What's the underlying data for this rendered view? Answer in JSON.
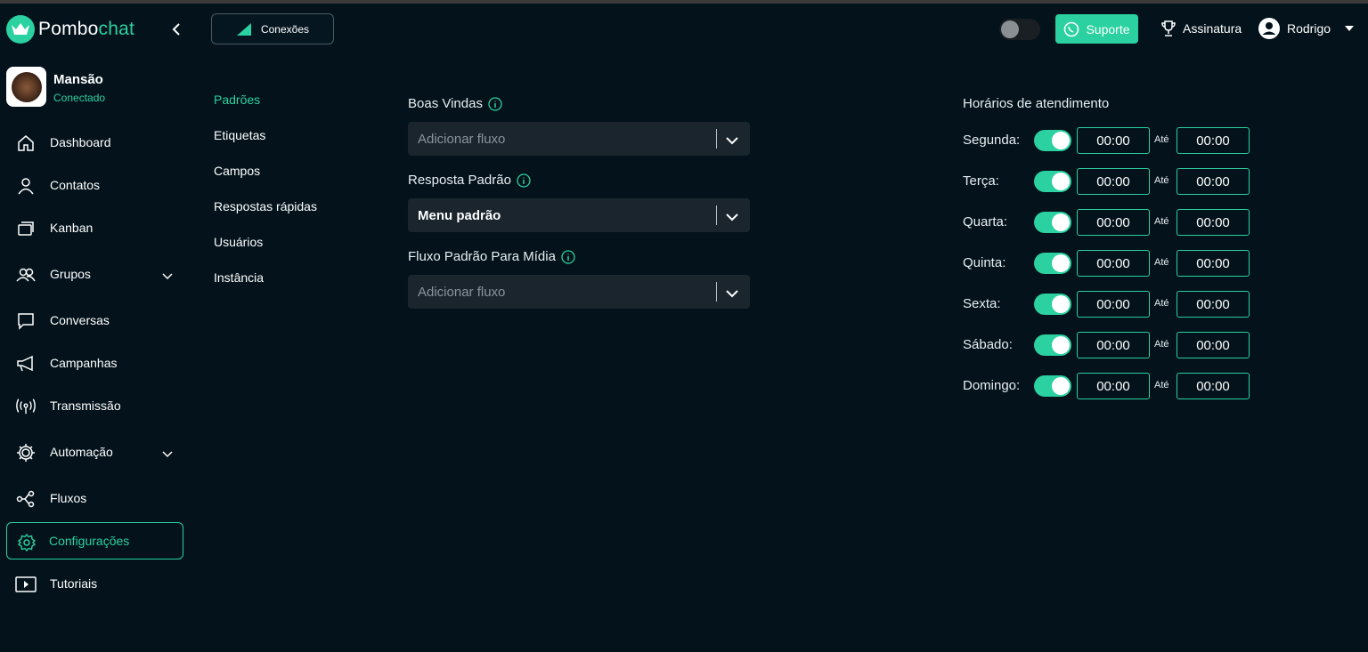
{
  "app": {
    "name_part1": "Pombo",
    "name_part2": "chat"
  },
  "header": {
    "conexoes_label": "Conexões",
    "suporte_label": "Suporte",
    "assinatura_label": "Assinatura",
    "user_name": "Rodrigo"
  },
  "instance": {
    "name": "Mansão",
    "status": "Conectado"
  },
  "sidebar": {
    "items": [
      {
        "label": "Dashboard",
        "icon": "home-icon"
      },
      {
        "label": "Contatos",
        "icon": "user-icon"
      },
      {
        "label": "Kanban",
        "icon": "kanban-icon"
      },
      {
        "label": "Grupos",
        "icon": "group-icon",
        "expandable": true
      },
      {
        "label": "Conversas",
        "icon": "chat-icon"
      },
      {
        "label": "Campanhas",
        "icon": "megaphone-icon"
      },
      {
        "label": "Transmissão",
        "icon": "broadcast-icon"
      },
      {
        "label": "Automação",
        "icon": "gear-cog-icon",
        "expandable": true
      },
      {
        "label": "Fluxos",
        "icon": "flow-icon"
      },
      {
        "label": "Configurações",
        "icon": "settings-icon",
        "active": true
      },
      {
        "label": "Tutoriais",
        "icon": "play-icon"
      }
    ]
  },
  "settings_menu": {
    "items": [
      "Padrões",
      "Etiquetas",
      "Campos",
      "Respostas rápidas",
      "Usuários",
      "Instância"
    ],
    "active": "Padrões"
  },
  "form": {
    "boas_vindas": {
      "label": "Boas Vindas",
      "placeholder": "Adicionar fluxo"
    },
    "resposta_padrao": {
      "label": "Resposta Padrão",
      "value": "Menu padrão"
    },
    "fluxo_midia": {
      "label": "Fluxo Padrão Para Mídia",
      "placeholder": "Adicionar fluxo"
    }
  },
  "hours": {
    "title": "Horários de atendimento",
    "ate_label": "Até",
    "days": [
      {
        "day": "Segunda:",
        "enabled": true,
        "from": "00:00",
        "to": "00:00"
      },
      {
        "day": "Terça:",
        "enabled": true,
        "from": "00:00",
        "to": "00:00"
      },
      {
        "day": "Quarta:",
        "enabled": true,
        "from": "00:00",
        "to": "00:00"
      },
      {
        "day": "Quinta:",
        "enabled": true,
        "from": "00:00",
        "to": "00:00"
      },
      {
        "day": "Sexta:",
        "enabled": true,
        "from": "00:00",
        "to": "00:00"
      },
      {
        "day": "Sábado:",
        "enabled": true,
        "from": "00:00",
        "to": "00:00"
      },
      {
        "day": "Domingo:",
        "enabled": true,
        "from": "00:00",
        "to": "00:00"
      }
    ]
  },
  "colors": {
    "accent": "#2bd1a0",
    "background": "#03121b",
    "select_bg": "#1a252d"
  }
}
